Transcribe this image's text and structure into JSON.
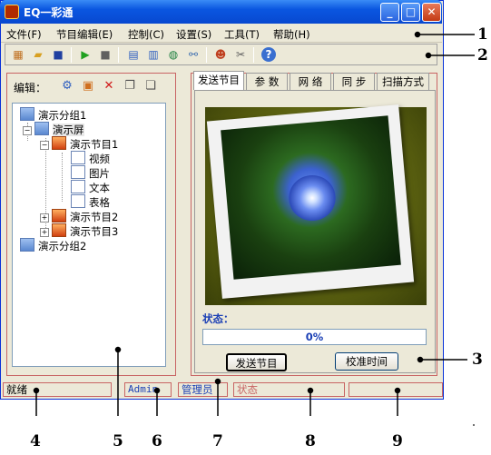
{
  "window": {
    "title": "EQ一彩通"
  },
  "menubar": [
    "文件(F)",
    "节目编辑(E)",
    "控制(C)",
    "设置(S)",
    "工具(T)",
    "帮助(H)"
  ],
  "edit_panel": {
    "label": "编辑："
  },
  "tree": {
    "group1": "演示分组1",
    "screen": "演示屏",
    "program1": "演示节目1",
    "video": "视频",
    "picture": "图片",
    "text": "文本",
    "table": "表格",
    "program2": "演示节目2",
    "program3": "演示节目3",
    "group2": "演示分组2"
  },
  "tabs": [
    "发送节目",
    "参  数",
    "网  络",
    "同  步",
    "扫描方式"
  ],
  "send_panel": {
    "status_label": "状态：",
    "progress": 0,
    "progress_text": "0%",
    "send_button": "发送节目",
    "calibrate_button": "校准时间"
  },
  "statusbar": {
    "ready": "就绪",
    "user": "Admin",
    "role": "管理员",
    "state": "状态",
    "extra": ""
  },
  "callouts": [
    "1",
    "2",
    "3",
    "4",
    "5",
    "6",
    "7",
    "8",
    "9"
  ],
  "colors": {
    "accent": "#c86464",
    "title_blue": "#0a56e0",
    "status_blue": "#1a3fb5"
  }
}
